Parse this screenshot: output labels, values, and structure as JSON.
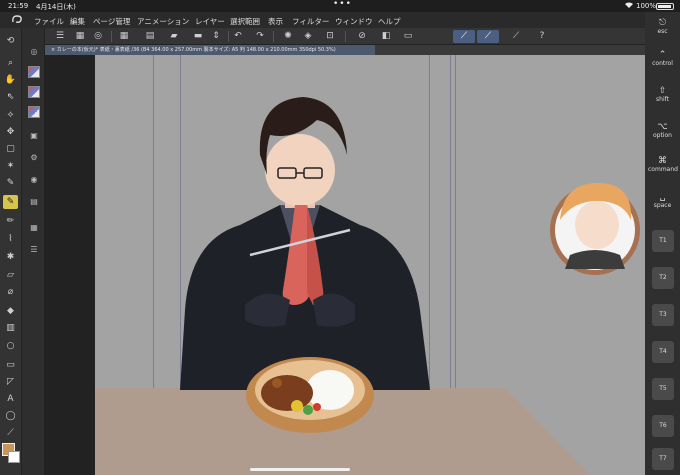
{
  "status": {
    "time": "21:59",
    "date": "4月14日(木)",
    "dots": "•••",
    "battery_pct": "100%"
  },
  "menu": {
    "items": [
      "ファイル",
      "編集",
      "ページ管理",
      "アニメーション",
      "レイヤー",
      "選択範囲",
      "表示",
      "フィルター",
      "ウィンドウ",
      "ヘルプ"
    ]
  },
  "doc_tab": {
    "label": "× カレーの本(仮元)* 表紙・裏表紙 /36 (B4 364.00 x 257.00mm 製本サイズ: A5 判 148.00 x 210.00mm 350dpi 50.3%)"
  },
  "keys": {
    "esc": "esc",
    "control": "control",
    "shift": "shift",
    "option": "option",
    "command": "command",
    "space": "space",
    "t_keys": [
      "T1",
      "T2",
      "T3",
      "T4",
      "T5",
      "T6",
      "T7"
    ]
  },
  "colors": {
    "main_color": "#c9955a",
    "sub_color": "#ffffff",
    "accent": "#4a5f82"
  }
}
